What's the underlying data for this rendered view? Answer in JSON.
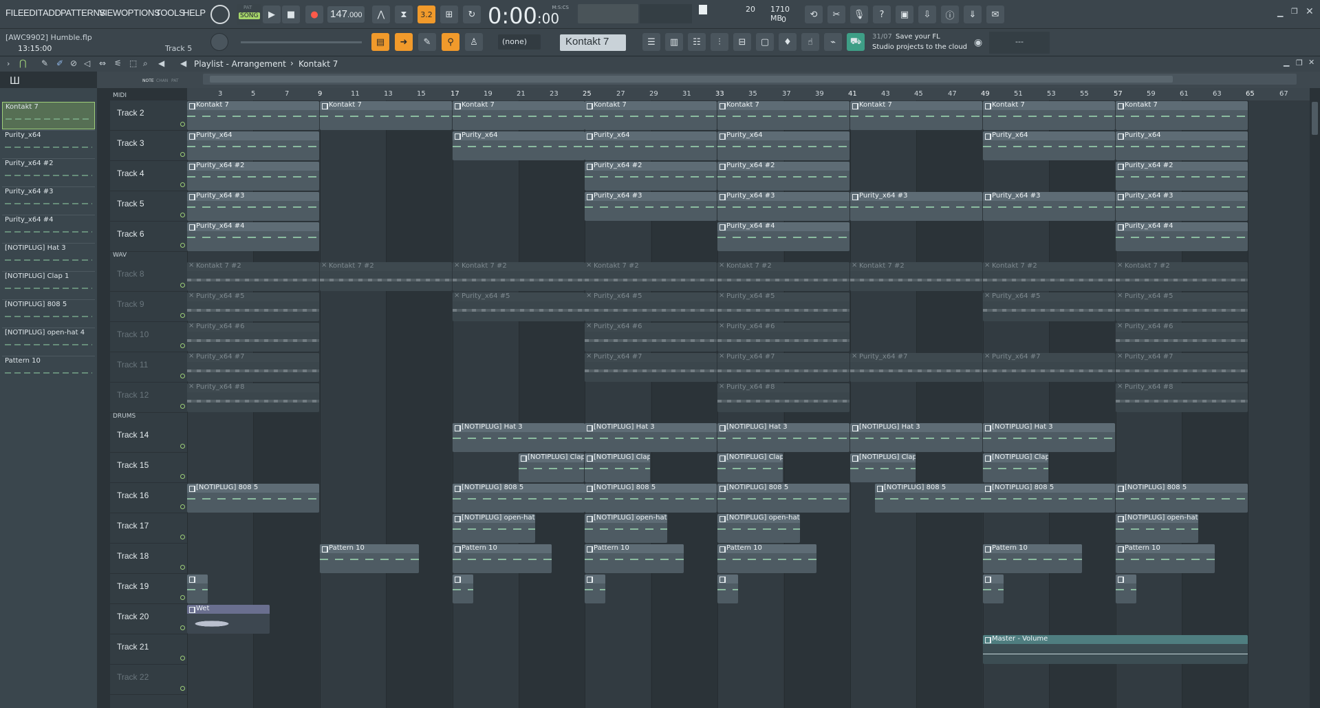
{
  "menu": [
    "FILE",
    "EDIT",
    "ADD",
    "PATTERNS",
    "VIEW",
    "OPTIONS",
    "TOOLS",
    "HELP"
  ],
  "transport": {
    "mode_label": "SONG",
    "pat_label": "PAT",
    "tempo": "147",
    "tempo_dec": ".000",
    "clock_main": "0:00",
    "clock_sub": "00",
    "clock_unit": "M:S:CS",
    "snap_step": "3.2",
    "cpu": "20",
    "mem": "1710 MB",
    "poly": "0"
  },
  "project": {
    "file": "[AWC9902] Humble.flp",
    "time": "13:15:00",
    "track_hint": "Track 5"
  },
  "channel": {
    "none": "(none)",
    "pattern": "Kontakt 7"
  },
  "news": {
    "date": "31/07",
    "line1": "Save your FL",
    "line2": "Studio projects to the cloud",
    "dashes": "---"
  },
  "playlist": {
    "title": "Playlist - Arrangement",
    "sep": "›",
    "pattern": "Kontakt 7"
  },
  "tools_labels": {
    "note": "NOTE",
    "chan": "CHAN",
    "pat": "PAT"
  },
  "picker": [
    "Kontakt 7",
    "Purity_x64",
    "Purity_x64 #2",
    "Purity_x64 #3",
    "Purity_x64 #4",
    "[NOTIPLUG] Hat 3",
    "[NOTIPLUG] Clap 1",
    "[NOTIPLUG] 808 5",
    "[NOTIPLUG] open-hat 4",
    "Pattern 10"
  ],
  "groups": {
    "midi": "MIDI",
    "wav": "WAV",
    "drums": "DRUMS"
  },
  "tracks": [
    {
      "label": "Track 2",
      "dim": false
    },
    {
      "label": "Track 3",
      "dim": false
    },
    {
      "label": "Track 4",
      "dim": false
    },
    {
      "label": "Track 5",
      "dim": false
    },
    {
      "label": "Track 6",
      "dim": false
    },
    {
      "label": "Track 8",
      "dim": true
    },
    {
      "label": "Track 9",
      "dim": true
    },
    {
      "label": "Track 10",
      "dim": true
    },
    {
      "label": "Track 11",
      "dim": true
    },
    {
      "label": "Track 12",
      "dim": true
    },
    {
      "label": "Track 14",
      "dim": false
    },
    {
      "label": "Track 15",
      "dim": false
    },
    {
      "label": "Track 16",
      "dim": false
    },
    {
      "label": "Track 17",
      "dim": false
    },
    {
      "label": "Track 18",
      "dim": false
    },
    {
      "label": "Track 19",
      "dim": false
    },
    {
      "label": "Track 20",
      "dim": false
    },
    {
      "label": "Track 21",
      "dim": false
    },
    {
      "label": "Track 22",
      "dim": true
    }
  ],
  "ruler": [
    "3",
    "5",
    "7",
    "9",
    "11",
    "13",
    "15",
    "17",
    "19",
    "21",
    "23",
    "25",
    "27",
    "29",
    "31",
    "33",
    "35",
    "37",
    "39",
    "41",
    "43",
    "45",
    "47",
    "49",
    "51",
    "53",
    "55",
    "57",
    "59",
    "61",
    "63",
    "65",
    "67"
  ],
  "clips": {
    "t2": {
      "label": "Kontakt 7",
      "starts": [
        1,
        9,
        17,
        25,
        33,
        41,
        49,
        57
      ],
      "len": 8
    },
    "t3": {
      "label": "Purity_x64",
      "starts": [
        1,
        17,
        25,
        33,
        49,
        57
      ],
      "len": 8
    },
    "t4": {
      "label": "Purity_x64 #2",
      "starts": [
        1,
        25,
        33,
        57
      ],
      "len": 8
    },
    "t5": {
      "label": "Purity_x64 #3",
      "starts": [
        1,
        25,
        33,
        41,
        49,
        57
      ],
      "len": 8
    },
    "t6": {
      "label": "Purity_x64 #4",
      "starts": [
        1,
        33,
        57
      ],
      "len": 8
    },
    "t8": {
      "label": "Kontakt 7 #2",
      "starts": [
        1,
        9,
        17,
        25,
        33,
        41,
        49,
        57
      ],
      "len": 8
    },
    "t9": {
      "label": "Purity_x64 #5",
      "starts": [
        1,
        17,
        25,
        33,
        49,
        57
      ],
      "len": 8
    },
    "t10": {
      "label": "Purity_x64 #6",
      "starts": [
        1,
        25,
        33,
        57
      ],
      "len": 8
    },
    "t11": {
      "label": "Purity_x64 #7",
      "starts": [
        1,
        25,
        33,
        41,
        49,
        57
      ],
      "len": 8
    },
    "t12": {
      "label": "Purity_x64 #8",
      "starts": [
        1,
        33,
        57
      ],
      "len": 8
    },
    "t14": {
      "label": "[NOTIPLUG] Hat 3",
      "starts": [
        17,
        25,
        33,
        41,
        49
      ],
      "len": 8
    },
    "t15": {
      "label": "[NOTIPLUG] Clap 1",
      "starts": [
        21,
        25,
        33,
        41,
        49
      ],
      "len": 4
    },
    "t16": {
      "label": "[NOTIPLUG] 808 5",
      "starts": [
        1,
        17,
        25,
        33,
        42.5,
        49,
        57
      ],
      "len": 8
    },
    "t17": {
      "label": "[NOTIPLUG] open-hat 4",
      "starts": [
        17,
        25,
        33,
        57
      ],
      "len": 5
    },
    "t18": {
      "label": "Pattern 10",
      "starts": [
        9,
        17,
        25,
        33,
        49,
        57
      ],
      "len": 6
    },
    "t19": {
      "label": "",
      "starts": [
        1,
        17,
        25,
        33,
        49,
        57
      ],
      "len": 1.3
    },
    "t20": {
      "label": "Wet",
      "starts": [
        1
      ],
      "len": 5
    },
    "t21": {
      "label": "Master - Volume",
      "starts": [
        49
      ],
      "len": 16
    }
  },
  "colors": {
    "accent": "#f19a2b",
    "led": "#9fd07a",
    "clip": "#4e5b63",
    "automation": "#4f7e80"
  },
  "icons": [
    "menu-icon",
    "play-icon",
    "stop-icon",
    "record-icon",
    "metronome-icon",
    "piano-roll-icon",
    "mixer-icon",
    "browser-icon",
    "plugin-icon",
    "help-icon",
    "save-icon",
    "cpu-icon",
    "globe-icon"
  ]
}
